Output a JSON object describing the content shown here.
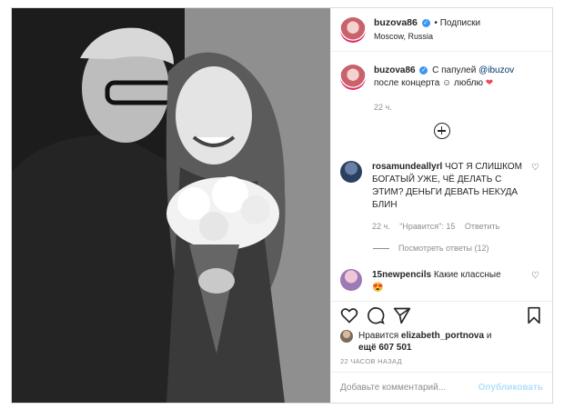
{
  "header": {
    "username": "buzova86",
    "separator": "•",
    "follow_label": "Подписки",
    "location": "Moscow, Russia"
  },
  "caption": {
    "username": "buzova86",
    "text_before": "С папулей",
    "mention": "@ibuzov",
    "text_line2": "после концерта ☺ люблю",
    "heart": "❤",
    "time": "22 ч."
  },
  "comments": [
    {
      "username": "rosamundeallyrl",
      "text": "ЧОТ Я СЛИШКОМ БОГАТЫЙ УЖЕ, ЧЁ ДЕЛАТЬ С ЭТИМ? ДЕНЬГИ ДЕВАТЬ НЕКУДА БЛИН",
      "time": "22 ч.",
      "likes": "\"Нравится\": 15",
      "reply": "Ответить",
      "view_replies": "Посмотреть ответы (12)"
    },
    {
      "username": "15newpencils",
      "text": "Какие классные",
      "emoji": "😍"
    }
  ],
  "likes": {
    "prefix": "Нравится",
    "user": "elizabeth_portnova",
    "suffix": "и",
    "count_text": "ещё 607 501"
  },
  "timestamp": "22 ЧАСОВ НАЗАД",
  "add_comment": {
    "placeholder": "Добавьте комментарий...",
    "publish_label": "Опубликовать"
  },
  "icons": {
    "like": "heart-icon",
    "comment": "comment-icon",
    "share": "share-icon",
    "save": "bookmark-icon",
    "add": "plus-circle-icon"
  },
  "colors": {
    "verified": "#3897f0",
    "mention": "#00376b",
    "heart": "#ed4956",
    "publish_disabled": "#b2dffc"
  }
}
